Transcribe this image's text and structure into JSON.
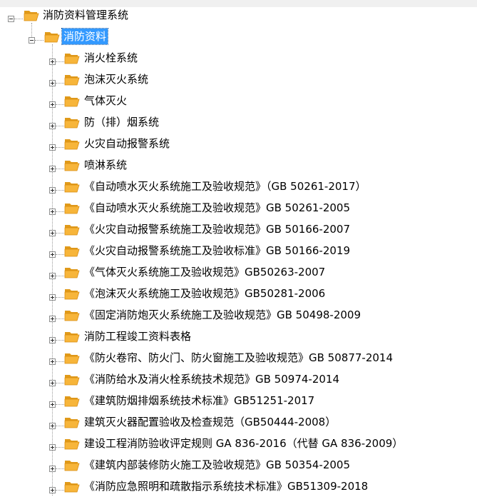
{
  "colors": {
    "selection_bg": "#3399ff",
    "selection_fg": "#ffffff",
    "folder": "#f5a623",
    "tree_lines": "#9a9a9a"
  },
  "tree": {
    "root": {
      "label": "消防资料管理系统",
      "icon": "folder-open-icon",
      "expanded": true
    },
    "selected": {
      "label": "消防资料",
      "icon": "folder-open-icon",
      "expanded": true
    },
    "children": [
      {
        "label": "消火栓系统",
        "icon": "folder-icon"
      },
      {
        "label": "泡沫灭火系统",
        "icon": "folder-icon"
      },
      {
        "label": "气体灭火",
        "icon": "folder-icon"
      },
      {
        "label": "防（排）烟系统",
        "icon": "folder-icon"
      },
      {
        "label": "火灾自动报警系统",
        "icon": "folder-icon"
      },
      {
        "label": "喷淋系统",
        "icon": "folder-icon"
      },
      {
        "label": "《自动喷水灭火系统施工及验收规范》（GB 50261-2017）",
        "icon": "folder-icon"
      },
      {
        "label": "《自动喷水灭火系统施工及验收规范》GB 50261-2005",
        "icon": "folder-icon"
      },
      {
        "label": "《火灾自动报警系统施工及验收规范》GB 50166-2007",
        "icon": "folder-icon"
      },
      {
        "label": "《火灾自动报警系统施工及验收标准》GB 50166-2019",
        "icon": "folder-icon"
      },
      {
        "label": "《气体灭火系统施工及验收规范》GB50263-2007",
        "icon": "folder-icon"
      },
      {
        "label": "《泡沫灭火系统施工及验收规范》GB50281-2006",
        "icon": "folder-icon"
      },
      {
        "label": "《固定消防炮灭火系统施工及验收规范》GB 50498-2009",
        "icon": "folder-icon"
      },
      {
        "label": "消防工程竣工资料表格",
        "icon": "folder-icon"
      },
      {
        "label": "《防火卷帘、防火门、防火窗施工及验收规范》GB 50877-2014",
        "icon": "folder-icon"
      },
      {
        "label": "《消防给水及消火栓系统技术规范》GB 50974-2014",
        "icon": "folder-icon"
      },
      {
        "label": "《建筑防烟排烟系统技术标准》GB51251-2017",
        "icon": "folder-icon"
      },
      {
        "label": "建筑灭火器配置验收及检查规范（GB50444-2008）",
        "icon": "folder-icon"
      },
      {
        "label": "建设工程消防验收评定规则 GA 836-2016（代替 GA 836-2009）",
        "icon": "folder-icon"
      },
      {
        "label": "《建筑内部装修防火施工及验收规范》GB 50354-2005",
        "icon": "folder-icon"
      },
      {
        "label": "《消防应急照明和疏散指示系统技术标准》GB51309-2018",
        "icon": "folder-icon"
      }
    ]
  }
}
